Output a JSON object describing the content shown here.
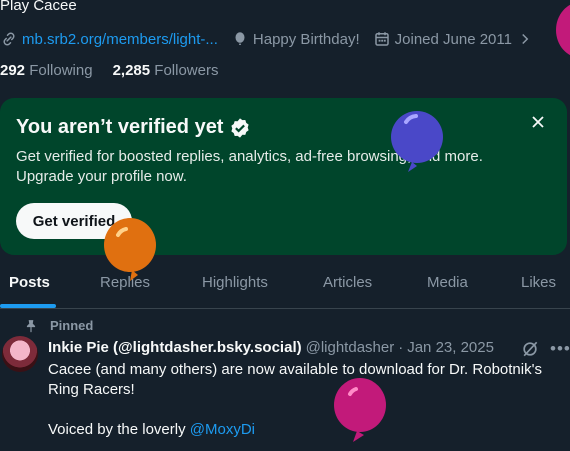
{
  "profile": {
    "bio": "Play Cacee",
    "website": "mb.srb2.org/members/light-...",
    "birthday": "Happy Birthday!",
    "joined": "Joined June 2011",
    "following_count": "292",
    "following_label": "Following",
    "followers_count": "2,285",
    "followers_label": "Followers"
  },
  "verify_card": {
    "title": "You aren’t verified yet",
    "description": "Get verified for boosted replies, analytics, ad-free browsing, and more. Upgrade your profile now.",
    "button_label": "Get verified",
    "background": "#00452b"
  },
  "tabs": [
    {
      "label": "Posts",
      "active": true
    },
    {
      "label": "Replies",
      "active": false
    },
    {
      "label": "Highlights",
      "active": false
    },
    {
      "label": "Articles",
      "active": false
    },
    {
      "label": "Media",
      "active": false
    },
    {
      "label": "Likes",
      "active": false
    }
  ],
  "post": {
    "pinned_label": "Pinned",
    "display_name": "Inkie Pie (@lightdasher.bsky.social)",
    "handle": "@lightdasher",
    "separator": "·",
    "date": "Jan 23, 2025",
    "text": "Cacee (and many others) are now available to download for Dr. Robotnik's Ring Racers!",
    "voiced_by": "Voiced by the loverly",
    "mention": "@MoxyDi"
  },
  "colors": {
    "background": "#15202b",
    "accent": "#1d9bf0",
    "balloon_blue": "#4a48c8",
    "balloon_orange": "#e07010",
    "balloon_pink": "#c21a7a"
  },
  "icons": [
    "link-icon",
    "balloon-icon",
    "calendar-icon",
    "chevron-right-icon",
    "verified-badge-icon",
    "close-icon",
    "pin-icon",
    "grok-icon",
    "more-icon"
  ]
}
